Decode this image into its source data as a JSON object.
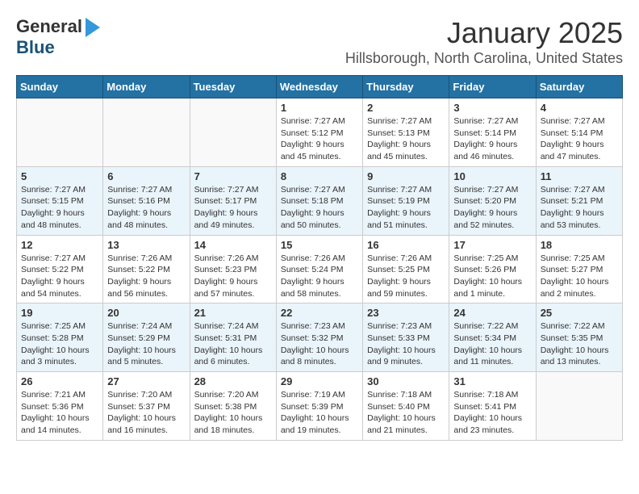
{
  "header": {
    "logo_general": "General",
    "logo_blue": "Blue",
    "title": "January 2025",
    "subtitle": "Hillsborough, North Carolina, United States"
  },
  "weekdays": [
    "Sunday",
    "Monday",
    "Tuesday",
    "Wednesday",
    "Thursday",
    "Friday",
    "Saturday"
  ],
  "weeks": [
    [
      {
        "day": "",
        "info": ""
      },
      {
        "day": "",
        "info": ""
      },
      {
        "day": "",
        "info": ""
      },
      {
        "day": "1",
        "info": "Sunrise: 7:27 AM\nSunset: 5:12 PM\nDaylight: 9 hours\nand 45 minutes."
      },
      {
        "day": "2",
        "info": "Sunrise: 7:27 AM\nSunset: 5:13 PM\nDaylight: 9 hours\nand 45 minutes."
      },
      {
        "day": "3",
        "info": "Sunrise: 7:27 AM\nSunset: 5:14 PM\nDaylight: 9 hours\nand 46 minutes."
      },
      {
        "day": "4",
        "info": "Sunrise: 7:27 AM\nSunset: 5:14 PM\nDaylight: 9 hours\nand 47 minutes."
      }
    ],
    [
      {
        "day": "5",
        "info": "Sunrise: 7:27 AM\nSunset: 5:15 PM\nDaylight: 9 hours\nand 48 minutes."
      },
      {
        "day": "6",
        "info": "Sunrise: 7:27 AM\nSunset: 5:16 PM\nDaylight: 9 hours\nand 48 minutes."
      },
      {
        "day": "7",
        "info": "Sunrise: 7:27 AM\nSunset: 5:17 PM\nDaylight: 9 hours\nand 49 minutes."
      },
      {
        "day": "8",
        "info": "Sunrise: 7:27 AM\nSunset: 5:18 PM\nDaylight: 9 hours\nand 50 minutes."
      },
      {
        "day": "9",
        "info": "Sunrise: 7:27 AM\nSunset: 5:19 PM\nDaylight: 9 hours\nand 51 minutes."
      },
      {
        "day": "10",
        "info": "Sunrise: 7:27 AM\nSunset: 5:20 PM\nDaylight: 9 hours\nand 52 minutes."
      },
      {
        "day": "11",
        "info": "Sunrise: 7:27 AM\nSunset: 5:21 PM\nDaylight: 9 hours\nand 53 minutes."
      }
    ],
    [
      {
        "day": "12",
        "info": "Sunrise: 7:27 AM\nSunset: 5:22 PM\nDaylight: 9 hours\nand 54 minutes."
      },
      {
        "day": "13",
        "info": "Sunrise: 7:26 AM\nSunset: 5:22 PM\nDaylight: 9 hours\nand 56 minutes."
      },
      {
        "day": "14",
        "info": "Sunrise: 7:26 AM\nSunset: 5:23 PM\nDaylight: 9 hours\nand 57 minutes."
      },
      {
        "day": "15",
        "info": "Sunrise: 7:26 AM\nSunset: 5:24 PM\nDaylight: 9 hours\nand 58 minutes."
      },
      {
        "day": "16",
        "info": "Sunrise: 7:26 AM\nSunset: 5:25 PM\nDaylight: 9 hours\nand 59 minutes."
      },
      {
        "day": "17",
        "info": "Sunrise: 7:25 AM\nSunset: 5:26 PM\nDaylight: 10 hours\nand 1 minute."
      },
      {
        "day": "18",
        "info": "Sunrise: 7:25 AM\nSunset: 5:27 PM\nDaylight: 10 hours\nand 2 minutes."
      }
    ],
    [
      {
        "day": "19",
        "info": "Sunrise: 7:25 AM\nSunset: 5:28 PM\nDaylight: 10 hours\nand 3 minutes."
      },
      {
        "day": "20",
        "info": "Sunrise: 7:24 AM\nSunset: 5:29 PM\nDaylight: 10 hours\nand 5 minutes."
      },
      {
        "day": "21",
        "info": "Sunrise: 7:24 AM\nSunset: 5:31 PM\nDaylight: 10 hours\nand 6 minutes."
      },
      {
        "day": "22",
        "info": "Sunrise: 7:23 AM\nSunset: 5:32 PM\nDaylight: 10 hours\nand 8 minutes."
      },
      {
        "day": "23",
        "info": "Sunrise: 7:23 AM\nSunset: 5:33 PM\nDaylight: 10 hours\nand 9 minutes."
      },
      {
        "day": "24",
        "info": "Sunrise: 7:22 AM\nSunset: 5:34 PM\nDaylight: 10 hours\nand 11 minutes."
      },
      {
        "day": "25",
        "info": "Sunrise: 7:22 AM\nSunset: 5:35 PM\nDaylight: 10 hours\nand 13 minutes."
      }
    ],
    [
      {
        "day": "26",
        "info": "Sunrise: 7:21 AM\nSunset: 5:36 PM\nDaylight: 10 hours\nand 14 minutes."
      },
      {
        "day": "27",
        "info": "Sunrise: 7:20 AM\nSunset: 5:37 PM\nDaylight: 10 hours\nand 16 minutes."
      },
      {
        "day": "28",
        "info": "Sunrise: 7:20 AM\nSunset: 5:38 PM\nDaylight: 10 hours\nand 18 minutes."
      },
      {
        "day": "29",
        "info": "Sunrise: 7:19 AM\nSunset: 5:39 PM\nDaylight: 10 hours\nand 19 minutes."
      },
      {
        "day": "30",
        "info": "Sunrise: 7:18 AM\nSunset: 5:40 PM\nDaylight: 10 hours\nand 21 minutes."
      },
      {
        "day": "31",
        "info": "Sunrise: 7:18 AM\nSunset: 5:41 PM\nDaylight: 10 hours\nand 23 minutes."
      },
      {
        "day": "",
        "info": ""
      }
    ]
  ]
}
